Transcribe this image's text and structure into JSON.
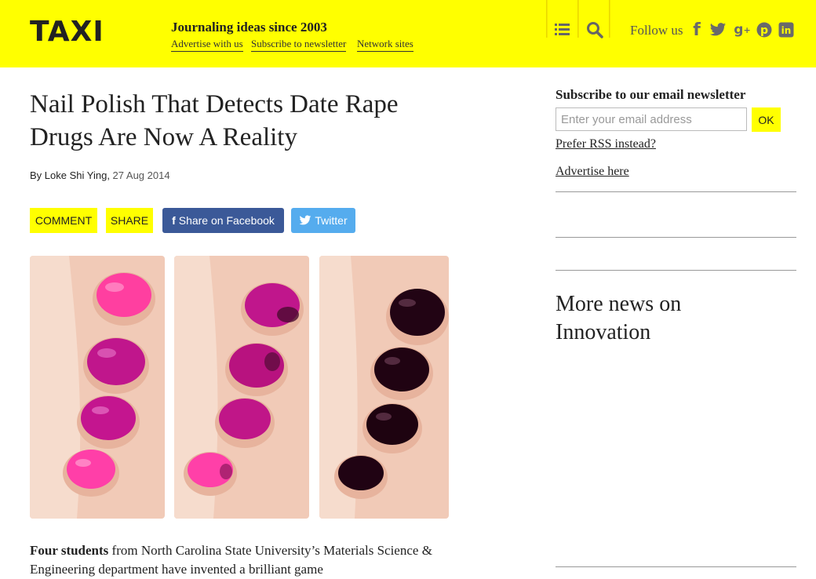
{
  "header": {
    "logo": "TAXI",
    "tagline": "Journaling ideas since 2003",
    "links": [
      "Advertise with us",
      "Subscribe to newsletter",
      "Network sites"
    ],
    "follow_label": "Follow us",
    "icons": [
      "list-icon",
      "search-icon",
      "facebook-icon",
      "twitter-icon",
      "google-plus-icon",
      "pinterest-icon",
      "linkedin-icon"
    ],
    "accent": "#ffff00"
  },
  "article": {
    "title": "Nail Polish That Detects Date Rape Drugs Are Now A Reality",
    "author_prefix": "By",
    "author": "Loke Shi Ying",
    "date": "27 Aug 2014",
    "buttons": {
      "comment": "COMMENT",
      "share": "SHARE",
      "facebook": "Share on Facebook",
      "twitter": "Twitter"
    },
    "intro_bold": "Four students",
    "intro_text": " from North Carolina State University’s Materials Science & Engineering department have invented a brilliant game"
  },
  "sidebar": {
    "newsletter_title": "Subscribe to our email newsletter",
    "email_placeholder": "Enter your email address",
    "ok_label": "OK",
    "rss_link": "Prefer RSS instead?",
    "advertise_link": "Advertise here",
    "more_news_line1": "More news on",
    "more_news_line2": "Innovation"
  }
}
